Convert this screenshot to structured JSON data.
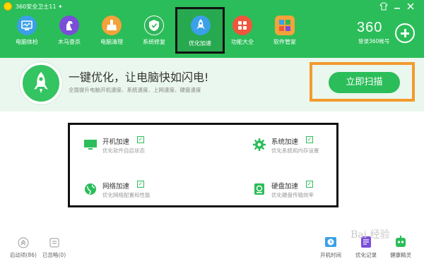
{
  "titlebar": {
    "app_title": "360安全卫士11 ✦",
    "icons": [
      "shirt-icon",
      "minimize-icon",
      "close-icon"
    ]
  },
  "nav": {
    "items": [
      {
        "label": "电脑体检",
        "icon": "monitor-icon",
        "color": "#3aa0e8"
      },
      {
        "label": "木马查杀",
        "icon": "horse-icon",
        "color": "#7a4ed8"
      },
      {
        "label": "电脑清理",
        "icon": "broom-icon",
        "color": "#f4a23a"
      },
      {
        "label": "系统修复",
        "icon": "shield-icon",
        "color": "#2fb65a"
      },
      {
        "label": "优化加速",
        "icon": "rocket-icon",
        "color": "#3aa0e8"
      },
      {
        "label": "功能大全",
        "icon": "grid-icon",
        "color": "#f0563c"
      },
      {
        "label": "软件管家",
        "icon": "apps-icon",
        "color": "#f4a23a"
      }
    ],
    "active_index": 4
  },
  "brand": {
    "logo_text": "360",
    "login_text": "登录360帐号"
  },
  "banner": {
    "headline": "一键优化，让电脑快如闪电!",
    "subline": "全面提升电脑开机速度、系统速度、上网速度、硬盘速度",
    "scan_button": "立即扫描"
  },
  "options": [
    {
      "title": "开机加速",
      "desc": "优化软件自启状态",
      "icon": "monitor-icon",
      "checked": true
    },
    {
      "title": "系统加速",
      "desc": "优化系统和内存设置",
      "icon": "gear-icon",
      "checked": true
    },
    {
      "title": "网络加速",
      "desc": "优化网络配置和性能",
      "icon": "globe-icon",
      "checked": true
    },
    {
      "title": "硬盘加速",
      "desc": "优化硬盘传输效率",
      "icon": "harddisk-icon",
      "checked": true
    }
  ],
  "bottom": {
    "startup": {
      "label": "启动项(86)",
      "icon": "double-chevron-up-icon"
    },
    "ignored": {
      "label": "已忽略(0)",
      "icon": "ignore-list-icon"
    },
    "right_items": [
      {
        "label": "开机时间",
        "icon": "clock-icon"
      },
      {
        "label": "优化记录",
        "icon": "record-icon"
      },
      {
        "label": "健康精灵",
        "icon": "robot-icon"
      }
    ]
  },
  "watermark": "Bai 经验"
}
